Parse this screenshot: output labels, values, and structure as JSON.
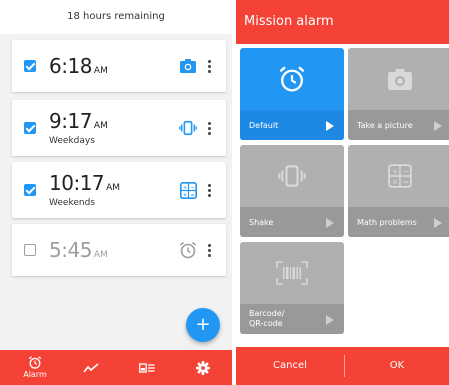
{
  "left": {
    "remaining_text": "18 hours remaining",
    "alarms": [
      {
        "time": "6:18",
        "ampm": "AM",
        "days": "",
        "enabled": true,
        "mission": "camera-icon"
      },
      {
        "time": "9:17",
        "ampm": "AM",
        "days": "Weekdays",
        "enabled": true,
        "mission": "shake-icon"
      },
      {
        "time": "10:17",
        "ampm": "AM",
        "days": "Weekends",
        "enabled": true,
        "mission": "math-icon"
      },
      {
        "time": "5:45",
        "ampm": "AM",
        "days": "",
        "enabled": false,
        "mission": "alarm-clock-icon"
      }
    ],
    "fab_label": "+",
    "nav": [
      {
        "label": "Alarm",
        "icon": "alarm-clock-icon"
      },
      {
        "label": "",
        "icon": "chart-icon"
      },
      {
        "label": "",
        "icon": "news-icon"
      },
      {
        "label": "",
        "icon": "gear-icon"
      }
    ]
  },
  "right": {
    "title": "Mission alarm",
    "missions": [
      {
        "label": "Default",
        "icon": "alarm-clock-icon",
        "selected": true
      },
      {
        "label": "Take a picture",
        "icon": "camera-icon",
        "selected": false
      },
      {
        "label": "Shake",
        "icon": "shake-icon",
        "selected": false
      },
      {
        "label": "Math problems",
        "icon": "math-icon",
        "selected": false
      },
      {
        "label_line1": "Barcode/",
        "label_line2": "QR-code",
        "icon": "barcode-icon",
        "selected": false
      }
    ],
    "cancel_label": "Cancel",
    "ok_label": "OK"
  },
  "colors": {
    "accent_red": "#f44336",
    "primary_blue": "#2196f3",
    "tile_grey": "#b0b0b0"
  }
}
